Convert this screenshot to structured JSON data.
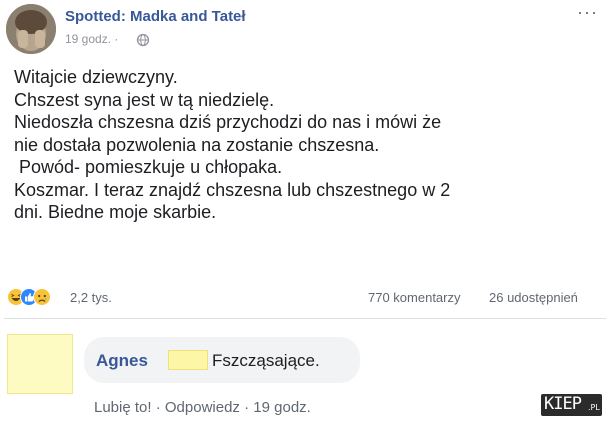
{
  "post": {
    "page_name": "Spotted: Madka and Tateł",
    "time": "19 godz. ·",
    "more": "···",
    "body_lines": [
      "Witajcie dziewczyny.",
      "Chszest syna jest w tą niedzielę.",
      "Niedoszła chszesna dziś przychodzi do nas i mówi że",
      "nie dostała pozwolenia na zostanie chszesna.",
      " Powód- pomieszkuje u chłopaka.",
      "Koszmar. I teraz znajdź chszesna lub chszestnego w 2",
      "dni. Biedne moje skarbie."
    ]
  },
  "stats": {
    "reaction_icons": [
      "laughing-icon",
      "like-icon",
      "sad-icon"
    ],
    "reactions_count": "2,2 tys.",
    "comments": "770 komentarzy",
    "shares": "26 udostępnień"
  },
  "comment": {
    "author": "Agnes",
    "text": "Fszcząsające.",
    "actions": {
      "like": "Lubię to!",
      "sep1": " · ",
      "reply": "Odpowiedz",
      "sep2": " · ",
      "time": "19 godz."
    }
  },
  "watermark": {
    "main": "KIEP",
    "sub": ".PL"
  },
  "colors": {
    "link": "#385898",
    "text": "#1c1e21",
    "secondary": "#606770",
    "censor": "#fdf6a6"
  }
}
